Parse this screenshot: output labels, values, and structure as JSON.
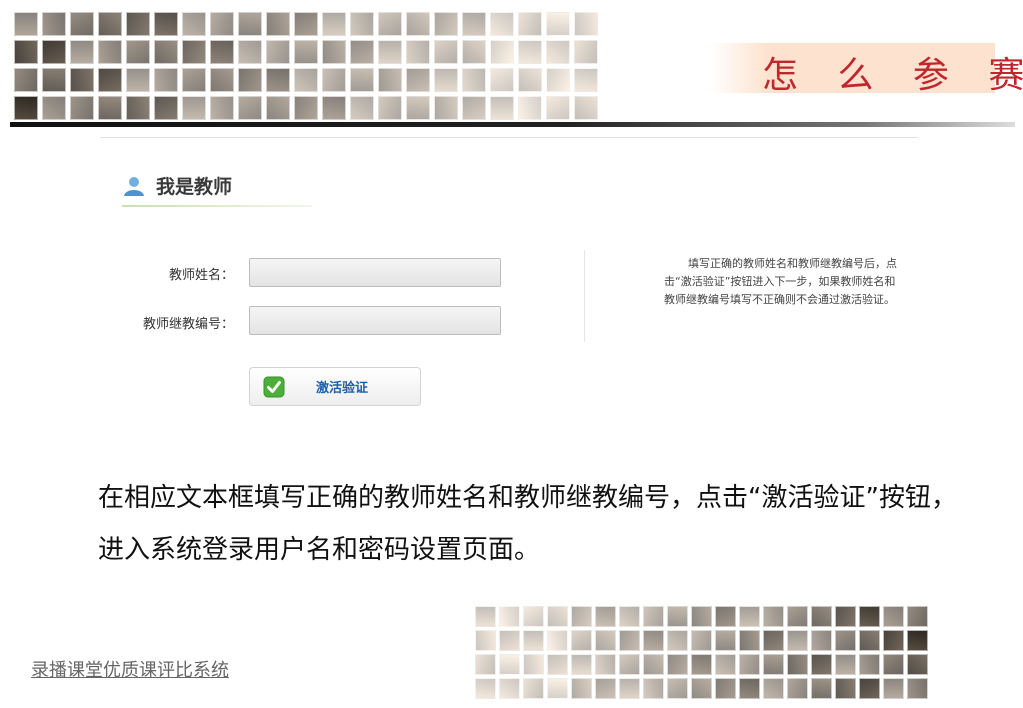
{
  "slide": {
    "title": "怎 么 参 赛",
    "body_text": "在相应文本框填写正确的教师姓名和教师继教编号，点击“激活验证”按钮，进入系统登录用户名和密码设置页面。",
    "footer_link": "录播课堂优质课评比系统"
  },
  "form": {
    "section_title": "我是教师",
    "section_icon": "user-icon",
    "fields": [
      {
        "label": "教师姓名：",
        "value": "",
        "placeholder": ""
      },
      {
        "label": "教师继教编号：",
        "value": "",
        "placeholder": ""
      }
    ],
    "submit": {
      "label": "激活验证",
      "icon": "checkmark-icon"
    },
    "hint": "填写正确的教师姓名和教师继教编号后，点击“激活验证”按钮进入下一步，如果教师姓名和教师继教编号填写不正确则不会通过激活验证。"
  },
  "colors": {
    "title_red": "#c0272d",
    "title_bg": "#fde3cf",
    "button_text": "#1e5fa8",
    "check_green": "#4caf3a"
  }
}
